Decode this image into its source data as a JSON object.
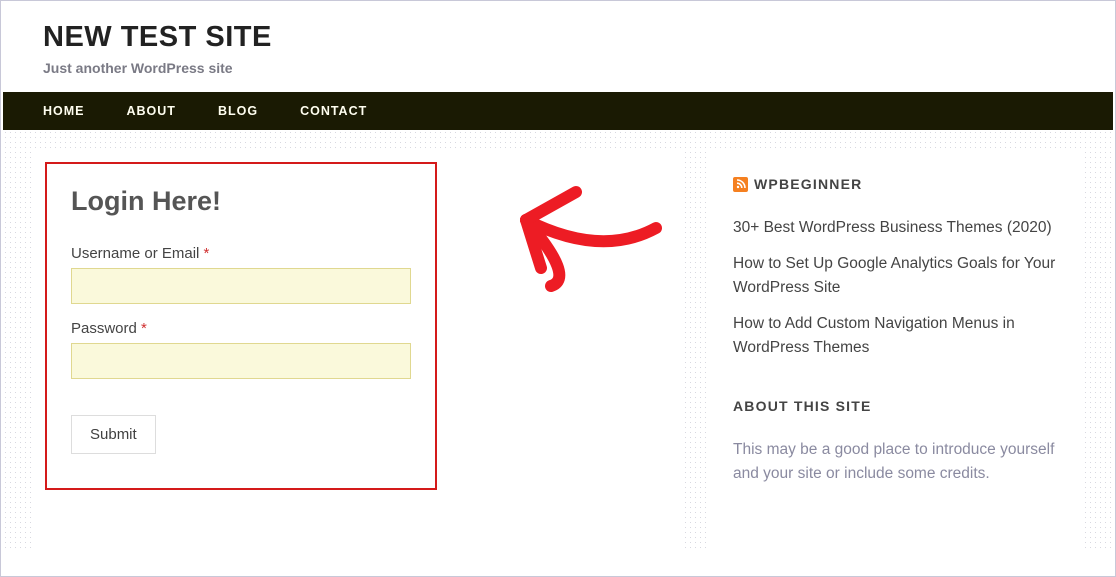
{
  "header": {
    "site_title": "NEW TEST SITE",
    "tagline": "Just another WordPress site"
  },
  "nav": {
    "items": [
      "HOME",
      "ABOUT",
      "BLOG",
      "CONTACT"
    ]
  },
  "login": {
    "title": "Login Here!",
    "username_label": "Username or Email",
    "password_label": "Password",
    "required_mark": "*",
    "submit_label": "Submit"
  },
  "sidebar": {
    "rss": {
      "title": "WPBEGINNER",
      "items": [
        "30+ Best WordPress Business Themes (2020)",
        "How to Set Up Google Analytics Goals for Your WordPress Site",
        "How to Add Custom Navigation Menus in WordPress Themes"
      ]
    },
    "about": {
      "title": "ABOUT THIS SITE",
      "body": "This may be a good place to introduce yourself and your site or include some credits."
    }
  },
  "annotation": {
    "arrow_color": "#ed1c24"
  }
}
